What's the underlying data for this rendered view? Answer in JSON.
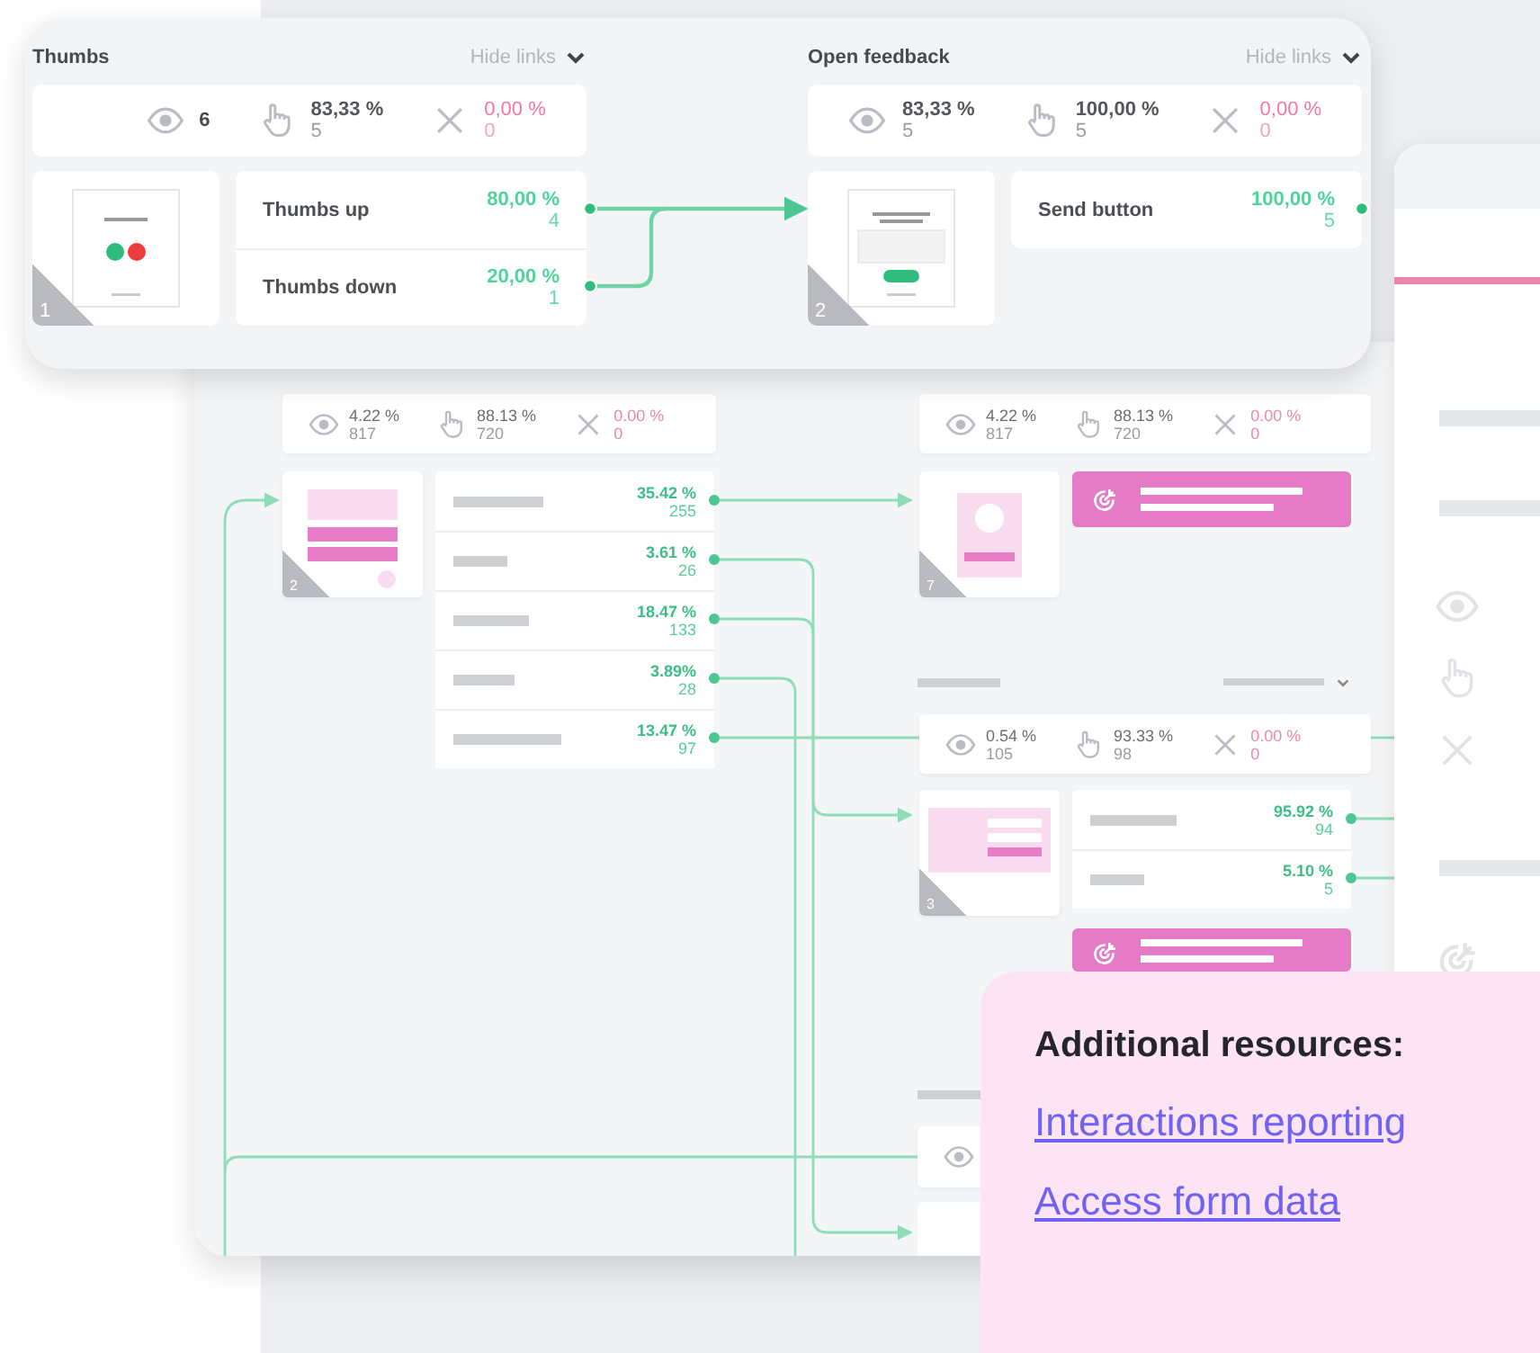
{
  "top_panel": {
    "blocks": [
      {
        "title": "Thumbs",
        "toggle": "Hide links",
        "stats": [
          {
            "kind": "views",
            "value": "6"
          },
          {
            "kind": "clicks",
            "value": "83,33 %",
            "count": "5"
          },
          {
            "kind": "closes",
            "value": "0,00 %",
            "count": "0"
          }
        ],
        "screen": {
          "number": "1",
          "kind": "thumbs"
        },
        "answers": [
          {
            "label": "Thumbs up",
            "percent": "80,00 %",
            "count": "4"
          },
          {
            "label": "Thumbs down",
            "percent": "20,00 %",
            "count": "1"
          }
        ]
      },
      {
        "title": "Open feedback",
        "toggle": "Hide links",
        "stats": [
          {
            "kind": "views",
            "value": "83,33 %",
            "count": "5"
          },
          {
            "kind": "clicks",
            "value": "100,00 %",
            "count": "5"
          },
          {
            "kind": "closes",
            "value": "0,00 %",
            "count": "0"
          }
        ],
        "screen": {
          "number": "2",
          "kind": "open_text"
        },
        "answers": [
          {
            "label": "Send button",
            "percent": "100,00 %",
            "count": "5"
          }
        ]
      }
    ]
  },
  "flow": {
    "blocks": [
      {
        "stats": [
          {
            "kind": "views",
            "value": "4.22 %",
            "count": "817"
          },
          {
            "kind": "clicks",
            "value": "88.13 %",
            "count": "720"
          },
          {
            "kind": "closes",
            "value": "0.00 %",
            "count": "0"
          }
        ],
        "screen": {
          "number": "2",
          "kind": "form"
        },
        "outputs": [
          {
            "kind": "answer",
            "percent": "35.42 %",
            "count": "255"
          },
          {
            "kind": "answer",
            "percent": "3.61 %",
            "count": "26"
          },
          {
            "kind": "answer",
            "percent": "18.47 %",
            "count": "133"
          },
          {
            "kind": "answer",
            "percent": "3.89%",
            "count": "28"
          },
          {
            "kind": "answer",
            "percent": "13.47 %",
            "count": "97"
          }
        ]
      },
      {
        "stats": [
          {
            "kind": "views",
            "value": "4.22 %",
            "count": "817"
          },
          {
            "kind": "clicks",
            "value": "88.13 %",
            "count": "720"
          },
          {
            "kind": "closes",
            "value": "0.00 %",
            "count": "0"
          }
        ],
        "screen": {
          "number": "7",
          "kind": "image"
        },
        "outputs": [
          {
            "kind": "goal"
          }
        ]
      },
      {
        "stats": [
          {
            "kind": "views",
            "value": "0.54 %",
            "count": "105"
          },
          {
            "kind": "clicks",
            "value": "93.33 %",
            "count": "98"
          },
          {
            "kind": "closes",
            "value": "0.00 %",
            "count": "0"
          }
        ],
        "screen": {
          "number": "3",
          "kind": "banner"
        },
        "outputs": [
          {
            "kind": "answer",
            "percent": "95.92 %",
            "count": "94"
          },
          {
            "kind": "answer",
            "percent": "5.10 %",
            "count": "5"
          },
          {
            "kind": "goal"
          }
        ]
      },
      {
        "stats": [
          {
            "kind": "views"
          }
        ]
      }
    ]
  },
  "resources": {
    "title": "Additional resources:",
    "links": [
      "Interactions reporting",
      "Access form data"
    ]
  }
}
